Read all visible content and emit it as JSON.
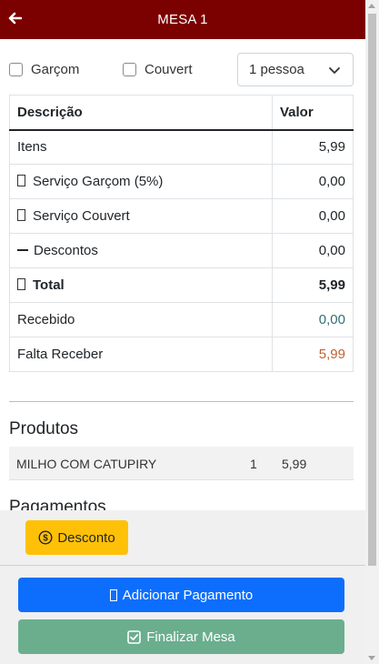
{
  "header": {
    "title": "MESA 1"
  },
  "options": {
    "garcom_label": "Garçom",
    "couvert_label": "Couvert",
    "people_select": "1 pessoa"
  },
  "summary": {
    "col_desc": "Descrição",
    "col_valor": "Valor",
    "rows": [
      {
        "label": "Itens",
        "value": "5,99"
      },
      {
        "label": "Serviço Garçom (5%)",
        "value": "0,00"
      },
      {
        "label": "Serviço Couvert",
        "value": "0,00"
      },
      {
        "label": "Descontos",
        "value": "0,00"
      },
      {
        "label": "Total",
        "value": "5,99"
      },
      {
        "label": "Recebido",
        "value": "0,00"
      },
      {
        "label": "Falta Receber",
        "value": "5,99"
      }
    ]
  },
  "produtos": {
    "title": "Produtos",
    "items": [
      {
        "name": "MILHO COM CATUPIRY",
        "qty": "1",
        "value": "5,99"
      }
    ]
  },
  "pagamentos": {
    "title": "Pagamentos"
  },
  "footer": {
    "desconto_label": "Desconto",
    "add_payment_label": "Adicionar Pagamento",
    "finalize_label": "Finalizar Mesa"
  },
  "colors": {
    "header_bg": "#7b0000",
    "desconto_bg": "#ffc107",
    "add_payment_bg": "#0d6efd",
    "finalize_bg": "#6aae8e",
    "received_text": "#2f6f73",
    "pending_text": "#c0622f"
  },
  "icons": {
    "back": "arrow-left-icon",
    "select": "chevron-down-icon",
    "desconto": "dollar-circle-icon",
    "finalize": "check-square-icon"
  }
}
